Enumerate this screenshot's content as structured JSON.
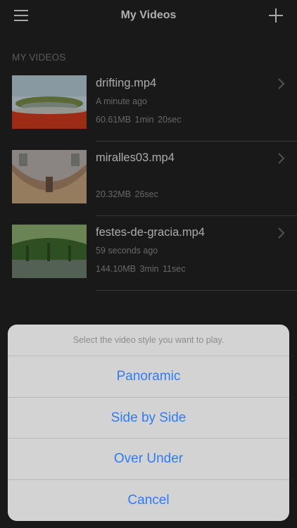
{
  "nav": {
    "title": "My Videos",
    "menu_icon": "hamburger-menu-icon",
    "add_icon": "plus-icon"
  },
  "section": {
    "header": "MY VIDEOS"
  },
  "videos": [
    {
      "title": "drifting.mp4",
      "subtitle": "A minute ago",
      "size": "60.61MB",
      "duration": "1min 20sec"
    },
    {
      "title": "miralles03.mp4",
      "subtitle": "",
      "size": "20.32MB",
      "duration": "26sec"
    },
    {
      "title": "festes-de-gracia.mp4",
      "subtitle": "59 seconds ago",
      "size": "144.10MB",
      "duration": "3min 11sec"
    }
  ],
  "action_sheet": {
    "message": "Select the video style you want to play.",
    "options": [
      "Panoramic",
      "Side by Side",
      "Over Under"
    ],
    "cancel": "Cancel"
  },
  "colors": {
    "background": "#222222",
    "accent_blue": "#2f7cf6",
    "sheet_bg": "#d3d3d3"
  }
}
